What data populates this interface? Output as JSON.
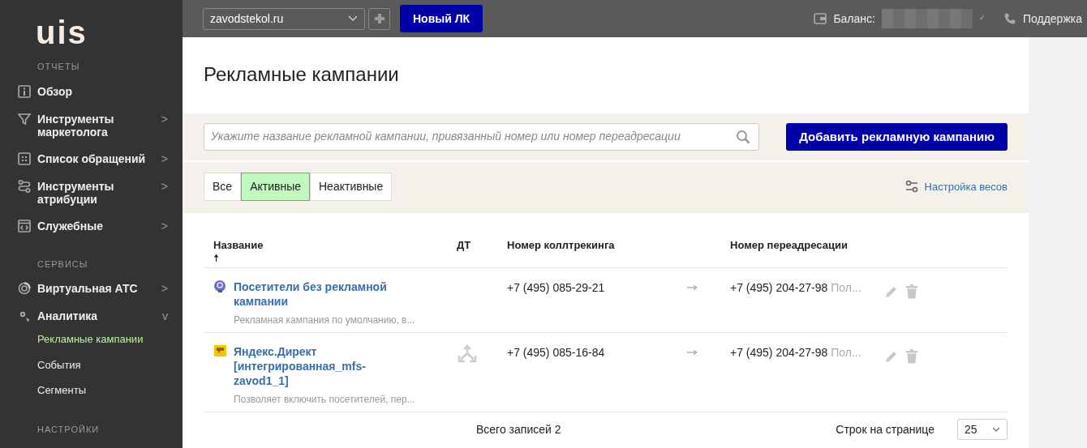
{
  "logo": "uis",
  "sidebar": [
    {
      "title": "ОТЧЕТЫ",
      "items": [
        {
          "label": "Обзор"
        },
        {
          "label": "Инструменты маркетолога",
          "chevron": ">"
        },
        {
          "label": "Список обращений",
          "chevron": ">"
        },
        {
          "label": "Инструменты атрибуции",
          "chevron": ">"
        },
        {
          "label": "Служебные",
          "chevron": ">"
        }
      ]
    },
    {
      "title": "СЕРВИСЫ",
      "items": [
        {
          "label": "Виртуальная АТС",
          "chevron": ">"
        },
        {
          "label": "Аналитика",
          "chevron": "v",
          "children": [
            {
              "label": "Рекламные кампании",
              "selected": true
            },
            {
              "label": "События",
              "selected": false
            },
            {
              "label": "Сегменты",
              "selected": false
            }
          ]
        }
      ]
    },
    {
      "title": "НАСТРОЙКИ"
    }
  ],
  "topbar": {
    "site": "zavodstekol.ru",
    "new_button": "Новый ЛК",
    "balance_label": "Баланс:",
    "balance_check": "✓",
    "support": "Поддержка"
  },
  "page_title": "Рекламные кампании",
  "search": {
    "placeholder": "Укажите название рекламной кампании, привязанный номер или номер переадресации"
  },
  "add_button": "Добавить рекламную кампанию",
  "filters": [
    {
      "label": "Все",
      "selected": false
    },
    {
      "label": "Активные",
      "selected": true
    },
    {
      "label": "Неактивные",
      "selected": false
    }
  ],
  "weights_link": "Настройка весов",
  "table": {
    "columns": [
      "Название",
      "ДТ",
      "Номер коллтрекинга",
      "Номер переадресации"
    ],
    "sort_mark": "🠅",
    "rows": [
      {
        "kind": "default",
        "name": "Посетители без рекламной кампании",
        "description": "Рекламная кампания по умолчанию, в...",
        "dt": false,
        "tracking": "+7 (495) 085-29-21",
        "redirect": "+7 (495) 204-27-98",
        "redirect_note": "Пол..."
      },
      {
        "kind": "yandex",
        "name": "Яндекс.Директ [интегрированная_mfs-zavod1_1]",
        "description": "Позволяет включить посетителей, пер...",
        "dt": true,
        "tracking": "+7 (495) 085-16-84",
        "redirect": "+7 (495) 204-27-98",
        "redirect_note": "Пол..."
      }
    ]
  },
  "footer": {
    "total": "Всего записей 2",
    "per_page_label": "Строк на странице",
    "per_page": "25"
  }
}
